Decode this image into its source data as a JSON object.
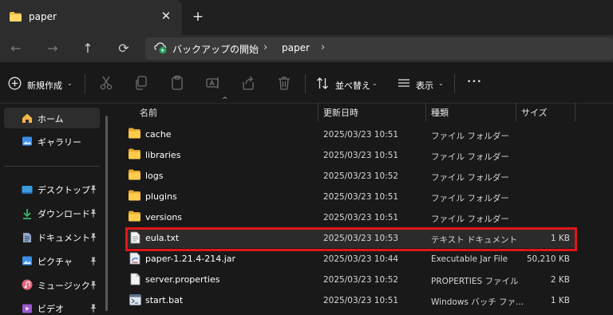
{
  "window": {
    "tab_title": "paper",
    "close_glyph": "✕",
    "new_tab_glyph": "+"
  },
  "nav": {
    "back_glyph": "←",
    "forward_glyph": "→",
    "up_glyph": "↑",
    "refresh_glyph": "⟳"
  },
  "address": {
    "segments": [
      "バックアップの開始",
      "paper"
    ],
    "chevron": "›"
  },
  "toolbar": {
    "new_label": "新規作成",
    "sort_label": "並べ替え",
    "view_label": "表示",
    "more_glyph": "•••",
    "chevron": "⌄"
  },
  "sidebar": {
    "items": [
      {
        "label": "ホーム",
        "icon": "home-icon"
      },
      {
        "label": "ギャラリー",
        "icon": "gallery-icon"
      },
      {
        "label": "デスクトップ",
        "icon": "desktop-icon",
        "pinned": true
      },
      {
        "label": "ダウンロード",
        "icon": "download-icon",
        "pinned": true
      },
      {
        "label": "ドキュメント",
        "icon": "documents-icon",
        "pinned": true
      },
      {
        "label": "ピクチャ",
        "icon": "pictures-icon",
        "pinned": true
      },
      {
        "label": "ミュージック",
        "icon": "music-icon",
        "pinned": true
      },
      {
        "label": "ビデオ",
        "icon": "video-icon",
        "pinned": true
      }
    ],
    "pin_glyph": "📌"
  },
  "columns": {
    "name": "名前",
    "modified": "更新日時",
    "type": "種類",
    "size": "サイズ"
  },
  "files": [
    {
      "name": "cache",
      "modified": "2025/03/23 10:51",
      "type": "ファイル フォルダー",
      "size": "",
      "icon": "folder-icon"
    },
    {
      "name": "libraries",
      "modified": "2025/03/23 10:51",
      "type": "ファイル フォルダー",
      "size": "",
      "icon": "folder-icon"
    },
    {
      "name": "logs",
      "modified": "2025/03/23 10:52",
      "type": "ファイル フォルダー",
      "size": "",
      "icon": "folder-icon"
    },
    {
      "name": "plugins",
      "modified": "2025/03/23 10:51",
      "type": "ファイル フォルダー",
      "size": "",
      "icon": "folder-icon"
    },
    {
      "name": "versions",
      "modified": "2025/03/23 10:51",
      "type": "ファイル フォルダー",
      "size": "",
      "icon": "folder-icon"
    },
    {
      "name": "eula.txt",
      "modified": "2025/03/23 10:53",
      "type": "テキスト ドキュメント",
      "size": "1 KB",
      "icon": "text-file-icon",
      "highlighted": true
    },
    {
      "name": "paper-1.21.4-214.jar",
      "modified": "2025/03/23 10:44",
      "type": "Executable Jar File",
      "size": "50,210 KB",
      "icon": "jar-file-icon"
    },
    {
      "name": "server.properties",
      "modified": "2025/03/23 10:52",
      "type": "PROPERTIES ファイル",
      "size": "2 KB",
      "icon": "file-icon"
    },
    {
      "name": "start.bat",
      "modified": "2025/03/23 10:51",
      "type": "Windows バッチ ファ...",
      "size": "1 KB",
      "icon": "batch-file-icon"
    }
  ],
  "colors": {
    "folder": "#f2c14e",
    "highlight": "#e0161b",
    "accent": "#2aa05a"
  }
}
